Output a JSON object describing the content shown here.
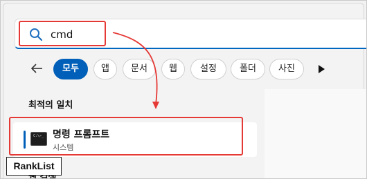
{
  "search": {
    "query": "cmd",
    "icon": "search-icon"
  },
  "filters": {
    "back_icon": "back-arrow-icon",
    "chips": [
      {
        "label": "모두",
        "active": true
      },
      {
        "label": "앱",
        "active": false
      },
      {
        "label": "문서",
        "active": false
      },
      {
        "label": "웹",
        "active": false
      },
      {
        "label": "설정",
        "active": false
      },
      {
        "label": "폴더",
        "active": false
      },
      {
        "label": "사진",
        "active": false
      }
    ],
    "more_icon": "play-icon"
  },
  "best_match": {
    "title": "최적의 일치",
    "item": {
      "name": "명령 프롬프트",
      "type": "시스템",
      "icon": "command-prompt-icon"
    }
  },
  "next_section": {
    "title": "웹 검색"
  },
  "watermark": {
    "text": "RankList"
  },
  "colors": {
    "accent": "#005fb8",
    "annotation": "#e53935"
  }
}
